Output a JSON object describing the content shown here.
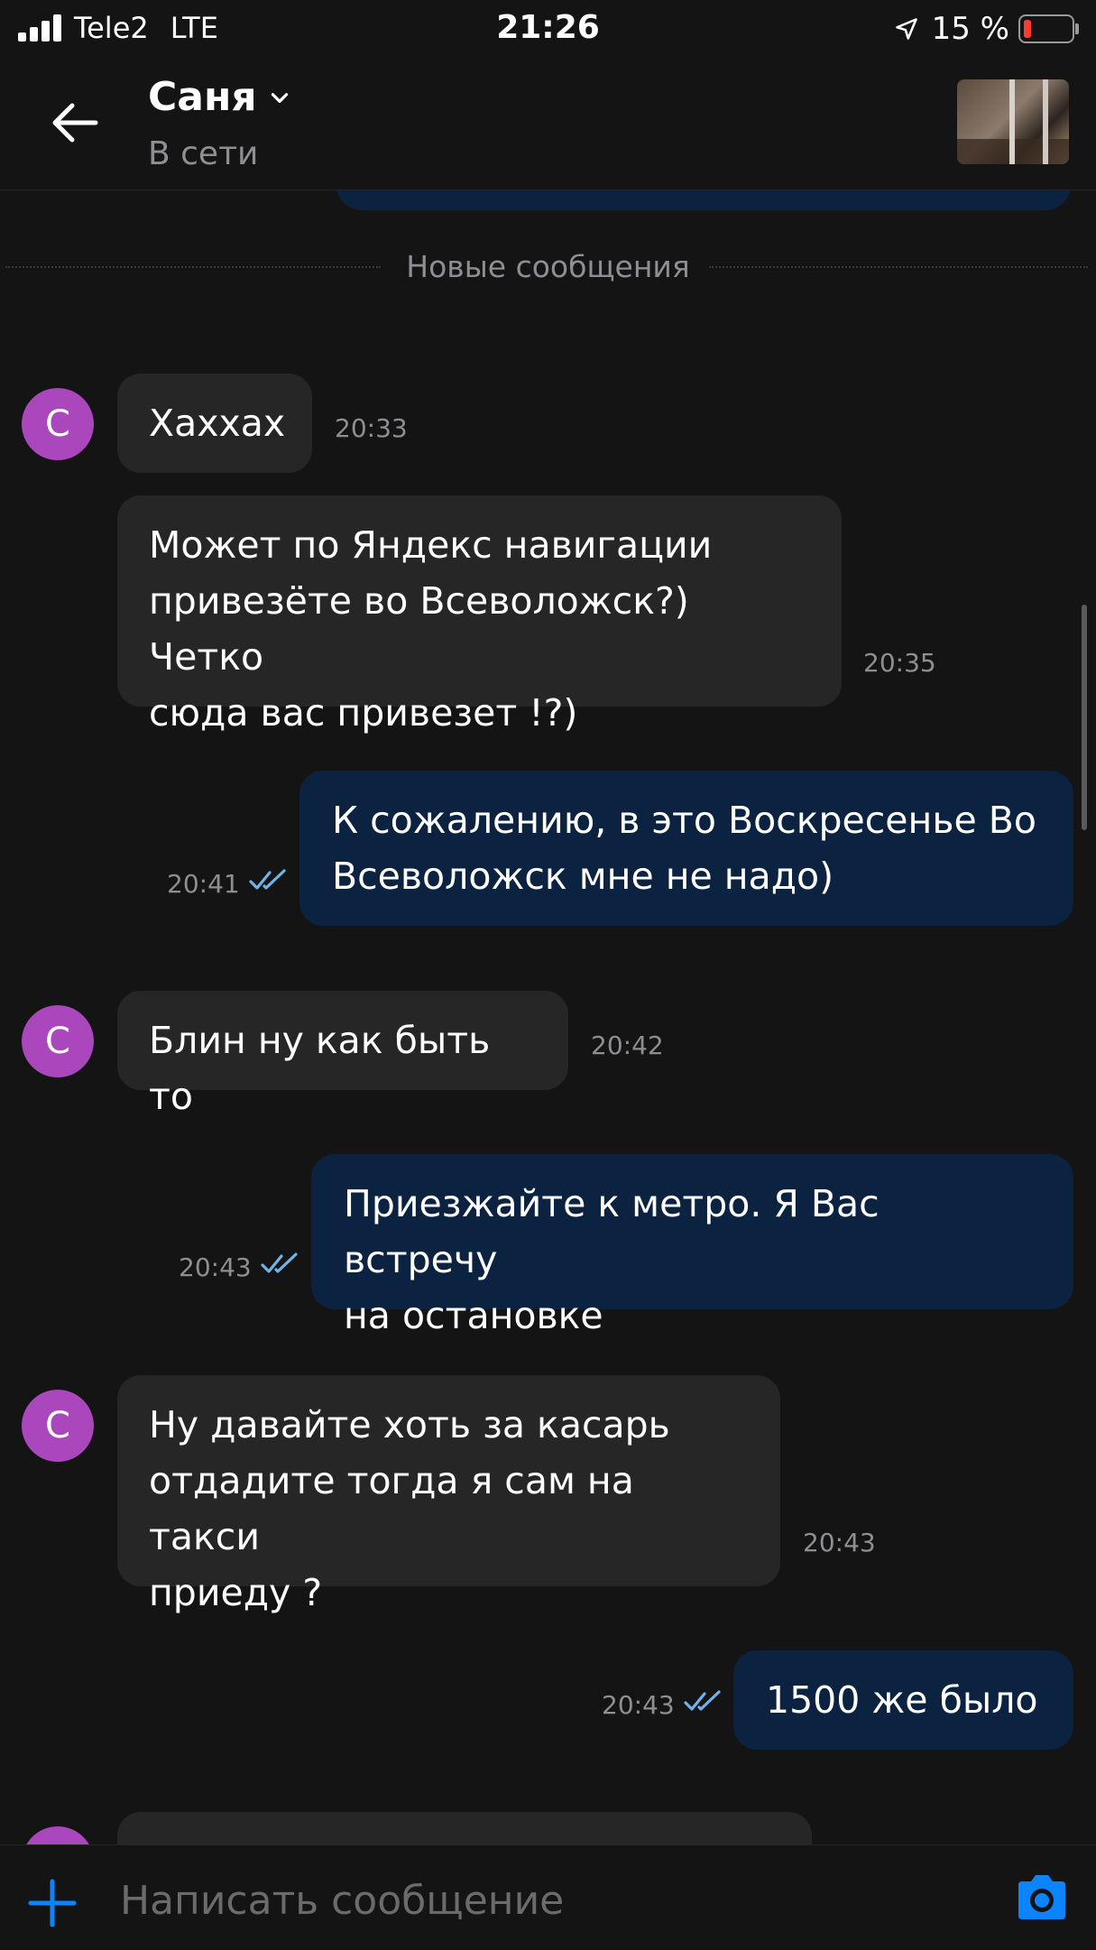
{
  "status_bar": {
    "carrier": "Tele2",
    "network": "LTE",
    "time": "21:26",
    "battery": "15 %"
  },
  "header": {
    "contact_name": "Саня",
    "status": "В сети"
  },
  "divider_label": "Новые сообщения",
  "avatar_letter": "С",
  "messages": [
    {
      "direction": "in",
      "lines": [
        "Хаххах"
      ],
      "time": "20:33"
    },
    {
      "direction": "in",
      "lines": [
        "Может по Яндекс навигации",
        "привезёте во Всеволожск?) Четко",
        "сюда вас привезет !?)"
      ],
      "time": "20:35"
    },
    {
      "direction": "out",
      "lines": [
        "К сожалению, в это Воскресенье Во",
        "Всеволожск мне не надо)"
      ],
      "time": "20:41",
      "read": true
    },
    {
      "direction": "in",
      "lines": [
        "Блин ну как быть то"
      ],
      "time": "20:42"
    },
    {
      "direction": "out",
      "lines": [
        "Приезжайте к метро. Я Вас встречу",
        "на остановке"
      ],
      "time": "20:43",
      "read": true
    },
    {
      "direction": "in",
      "lines": [
        "Ну давайте хоть за касарь",
        "отдадите тогда  я сам на такси",
        "приеду ?"
      ],
      "time": "20:43"
    },
    {
      "direction": "out",
      "lines": [
        "1500 же было"
      ],
      "time": "20:43",
      "read": true
    }
  ],
  "input": {
    "placeholder": "Написать сообщение"
  },
  "colors": {
    "background": "#141414",
    "incoming_bubble": "#262626",
    "outgoing_bubble": "#0b2240",
    "avatar": "#ab47bc",
    "accent": "#0a84ff",
    "read_ticks": "#6fb3e8"
  },
  "icons": [
    "signal-icon",
    "location-arrow-icon",
    "battery-icon",
    "back-arrow-icon",
    "chevron-down-icon",
    "read-ticks-icon",
    "plus-icon",
    "camera-icon"
  ]
}
